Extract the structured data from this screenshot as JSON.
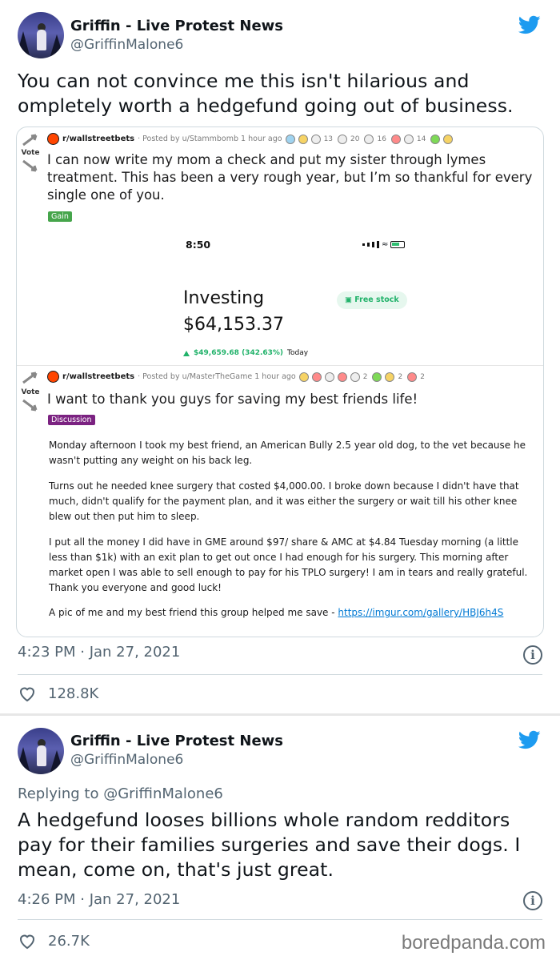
{
  "tweet1": {
    "display_name": "Griffin - Live Protest News",
    "handle": "@GriffinMalone6",
    "text_line1": "You can not convince me this isn't hilarious and",
    "text_line2": "ompletely worth a hedgefund going out of business.",
    "timestamp": "4:23 PM · Jan 27, 2021",
    "likes": "128.8K"
  },
  "embed": {
    "vote_label": "Vote",
    "post1": {
      "subreddit": "r/wallstreetbets",
      "posted_by": "· Posted by u/Stammbomb 1 hour ago",
      "award_counts": [
        "13",
        "20",
        "16",
        "14"
      ],
      "title": "I can now write my mom a check and put my sister through lymes treatment. This has been a very rough year, but I’m so thankful for every single one of you.",
      "flair": "Gain",
      "phone": {
        "time": "8:50",
        "label": "Investing",
        "value": "$64,153.37",
        "free_stock": "Free stock",
        "gain": "$49,659.68 (342.63%)",
        "period": "Today"
      }
    },
    "post2": {
      "subreddit": "r/wallstreetbets",
      "posted_by": "· Posted by u/MasterTheGame 1 hour ago",
      "award_counts": [
        "2",
        "2",
        "2"
      ],
      "title": "I want to thank you guys for saving my best friends life!",
      "flair": "Discussion",
      "paragraphs": [
        "Monday afternoon I took my best friend, an American Bully 2.5 year old dog, to the vet because he wasn't putting any weight on his back leg.",
        "Turns out he needed knee surgery that costed $4,000.00. I broke down because I didn't have that much, didn't qualify for the payment plan, and it was either the surgery or wait till his other knee blew out then put him to sleep.",
        "I put all the money I did have in GME around $97/ share & AMC at $4.84 Tuesday morning (a little less than $1k) with an exit plan to get out once I had enough for his surgery. This morning after market open I was able to sell enough to pay for his TPLO surgery! I am in tears and really grateful. Thank you everyone and good luck!"
      ],
      "link_prefix": "A pic of me and my best friend this group helped me save - ",
      "link_text": "https://imgur.com/gallery/HBJ6h4S"
    }
  },
  "tweet2": {
    "display_name": "Griffin - Live Protest News",
    "handle": "@GriffinMalone6",
    "replying_to": "Replying to @GriffinMalone6",
    "text_line1": "A hedgefund looses billions whole random redditors",
    "text_line2": "pay for their families surgeries and save their dogs. I",
    "text_line3": "mean, come on, that's just great.",
    "timestamp": "4:26 PM · Jan 27, 2021",
    "likes": "26.7K"
  },
  "watermark": "boredpanda.com",
  "colors": {
    "twitter_blue": "#1d9bf0",
    "secondary_text": "#536471",
    "gain_green": "#21b26a",
    "flair_gain": "#46a54b",
    "flair_discussion": "#7b2281"
  }
}
